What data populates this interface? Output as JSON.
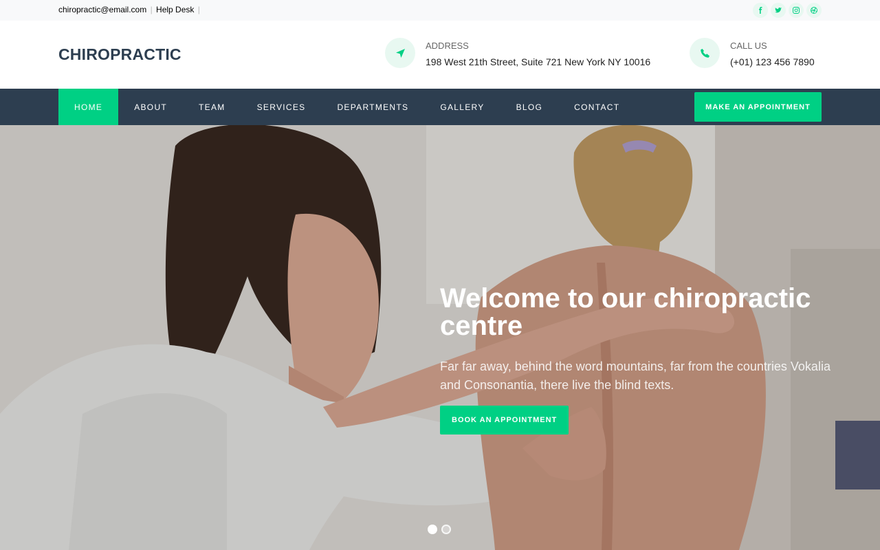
{
  "topbar": {
    "email": "chiropractic@email.com",
    "help": "Help Desk",
    "sep": "|",
    "social": [
      "facebook-icon",
      "twitter-icon",
      "instagram-icon",
      "dribbble-icon"
    ]
  },
  "header": {
    "logo": "CHIROPRACTIC",
    "address_label": "ADDRESS",
    "address_value": "198 West 21th Street, Suite 721 New York NY 10016",
    "call_label": "CALL US",
    "call_value": "(+01) 123 456 7890"
  },
  "nav": {
    "items": [
      {
        "label": "HOME",
        "active": true
      },
      {
        "label": "ABOUT"
      },
      {
        "label": "TEAM"
      },
      {
        "label": "SERVICES"
      },
      {
        "label": "DEPARTMENTS"
      },
      {
        "label": "GALLERY"
      },
      {
        "label": "BLOG"
      },
      {
        "label": "CONTACT"
      }
    ],
    "cta": "MAKE AN APPOINTMENT"
  },
  "hero": {
    "title": "Welcome to our chiropractic centre",
    "text": "Far far away, behind the word mountains, far from the countries Vokalia and Consonantia, there live the blind texts.",
    "button": "BOOK AN APPOINTMENT",
    "slides": 2,
    "active_slide": 1
  },
  "colors": {
    "accent": "#00d084",
    "nav_bg": "#2d3e50"
  }
}
